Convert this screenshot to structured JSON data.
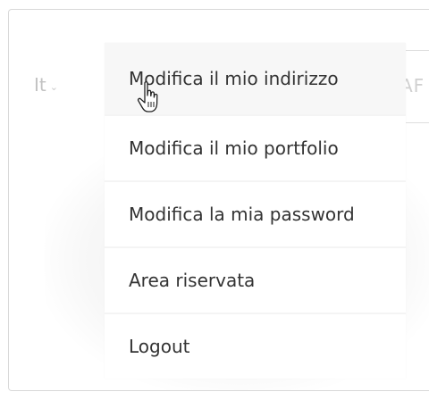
{
  "language": {
    "label": "It",
    "icon": "chevron-down-icon"
  },
  "background_text": "AF",
  "menu": {
    "items": [
      {
        "label": "Modifica il mio indirizzo",
        "state": "hover"
      },
      {
        "label": "Modifica il mio portfolio"
      },
      {
        "label": "Modifica la mia password"
      },
      {
        "label": "Area riservata"
      },
      {
        "label": "Logout"
      }
    ]
  },
  "cursor": {
    "icon": "hand-pointer-icon"
  }
}
